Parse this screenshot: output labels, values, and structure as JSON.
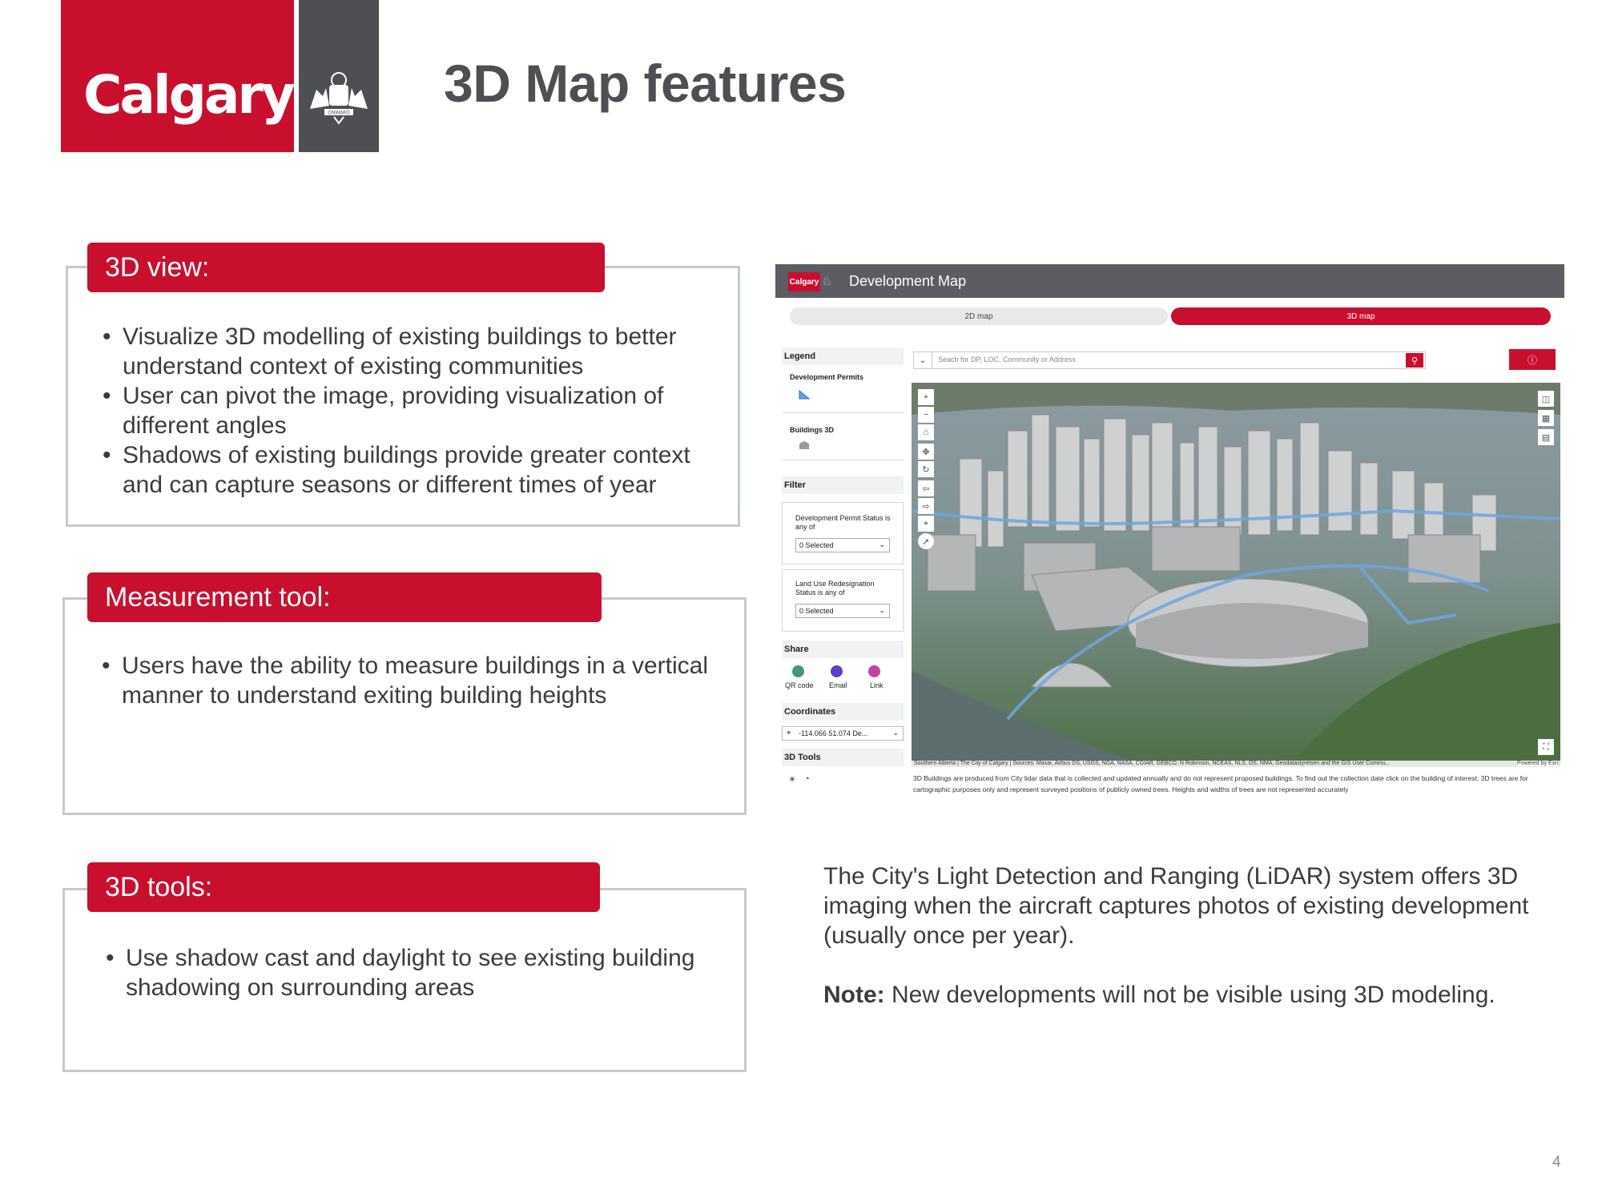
{
  "logo": {
    "text": "Calgary",
    "crest_motto": "ONWARD"
  },
  "title": "3D Map features",
  "sections": [
    {
      "tab": "3D view:",
      "bullets": [
        "Visualize 3D modelling of existing buildings to better understand context of existing communities",
        "User can pivot the image, providing visualization of different angles",
        "Shadows of existing buildings provide greater context and can capture seasons or different times of year"
      ]
    },
    {
      "tab": "Measurement tool:",
      "bullets": [
        "Users have the ability to measure buildings in a vertical manner to understand exiting building heights"
      ]
    },
    {
      "tab": "3D tools:",
      "bullets": [
        "Use shadow cast and daylight to see existing building shadowing on surrounding areas"
      ]
    }
  ],
  "description": {
    "paragraph": "The City's Light Detection and Ranging (LiDAR) system offers 3D imaging when the aircraft captures photos of existing development (usually once per year).",
    "note_label": "Note:",
    "note_text": " New developments will not be visible using 3D modeling."
  },
  "page_number": "4",
  "screenshot": {
    "logo": "Calgary",
    "app_title": "Development Map",
    "tabs": [
      "2D map",
      "3D map"
    ],
    "active_tab": "3D map",
    "legend": {
      "heading": "Legend",
      "items": [
        "Development Permits",
        "Buildings 3D"
      ]
    },
    "filter": {
      "heading": "Filter",
      "filters": [
        {
          "label": "Development Permit Status is any of",
          "value": "0 Selected"
        },
        {
          "label": "Land Use Redesignation Status is any of",
          "value": "0 Selected"
        }
      ]
    },
    "share": {
      "heading": "Share",
      "items": [
        "QR code",
        "Email",
        "Link"
      ]
    },
    "coordinates": {
      "heading": "Coordinates",
      "value": "-114.066 51.074 De..."
    },
    "tools": {
      "heading": "3D Tools"
    },
    "search_placeholder": "Seach for DP, LOC, Community or Address",
    "attribution": "Southern Alberta | The City of Calgary | Sources: Maxar, Airbus DS, USGS, NGA, NASA, CGIAR, GEBCO, N Robinson, NCEAS, NLS, OS, NMA, Geodatastyrelsen and the GIS User Commu...",
    "powered_by": "Powered by Esri",
    "note": "3D Buildings are produced from City lidar data that is collected and updated annually and do not represent proposed buildings. To find out the collection date click on the building of interest. 3D trees are for cartographic purposes only and represent surveyed positions of publicly owned trees. Heights and widths of trees are not represented accurately",
    "colors": {
      "brand_red": "#c8102e",
      "header_grey": "#5b5d62"
    }
  }
}
